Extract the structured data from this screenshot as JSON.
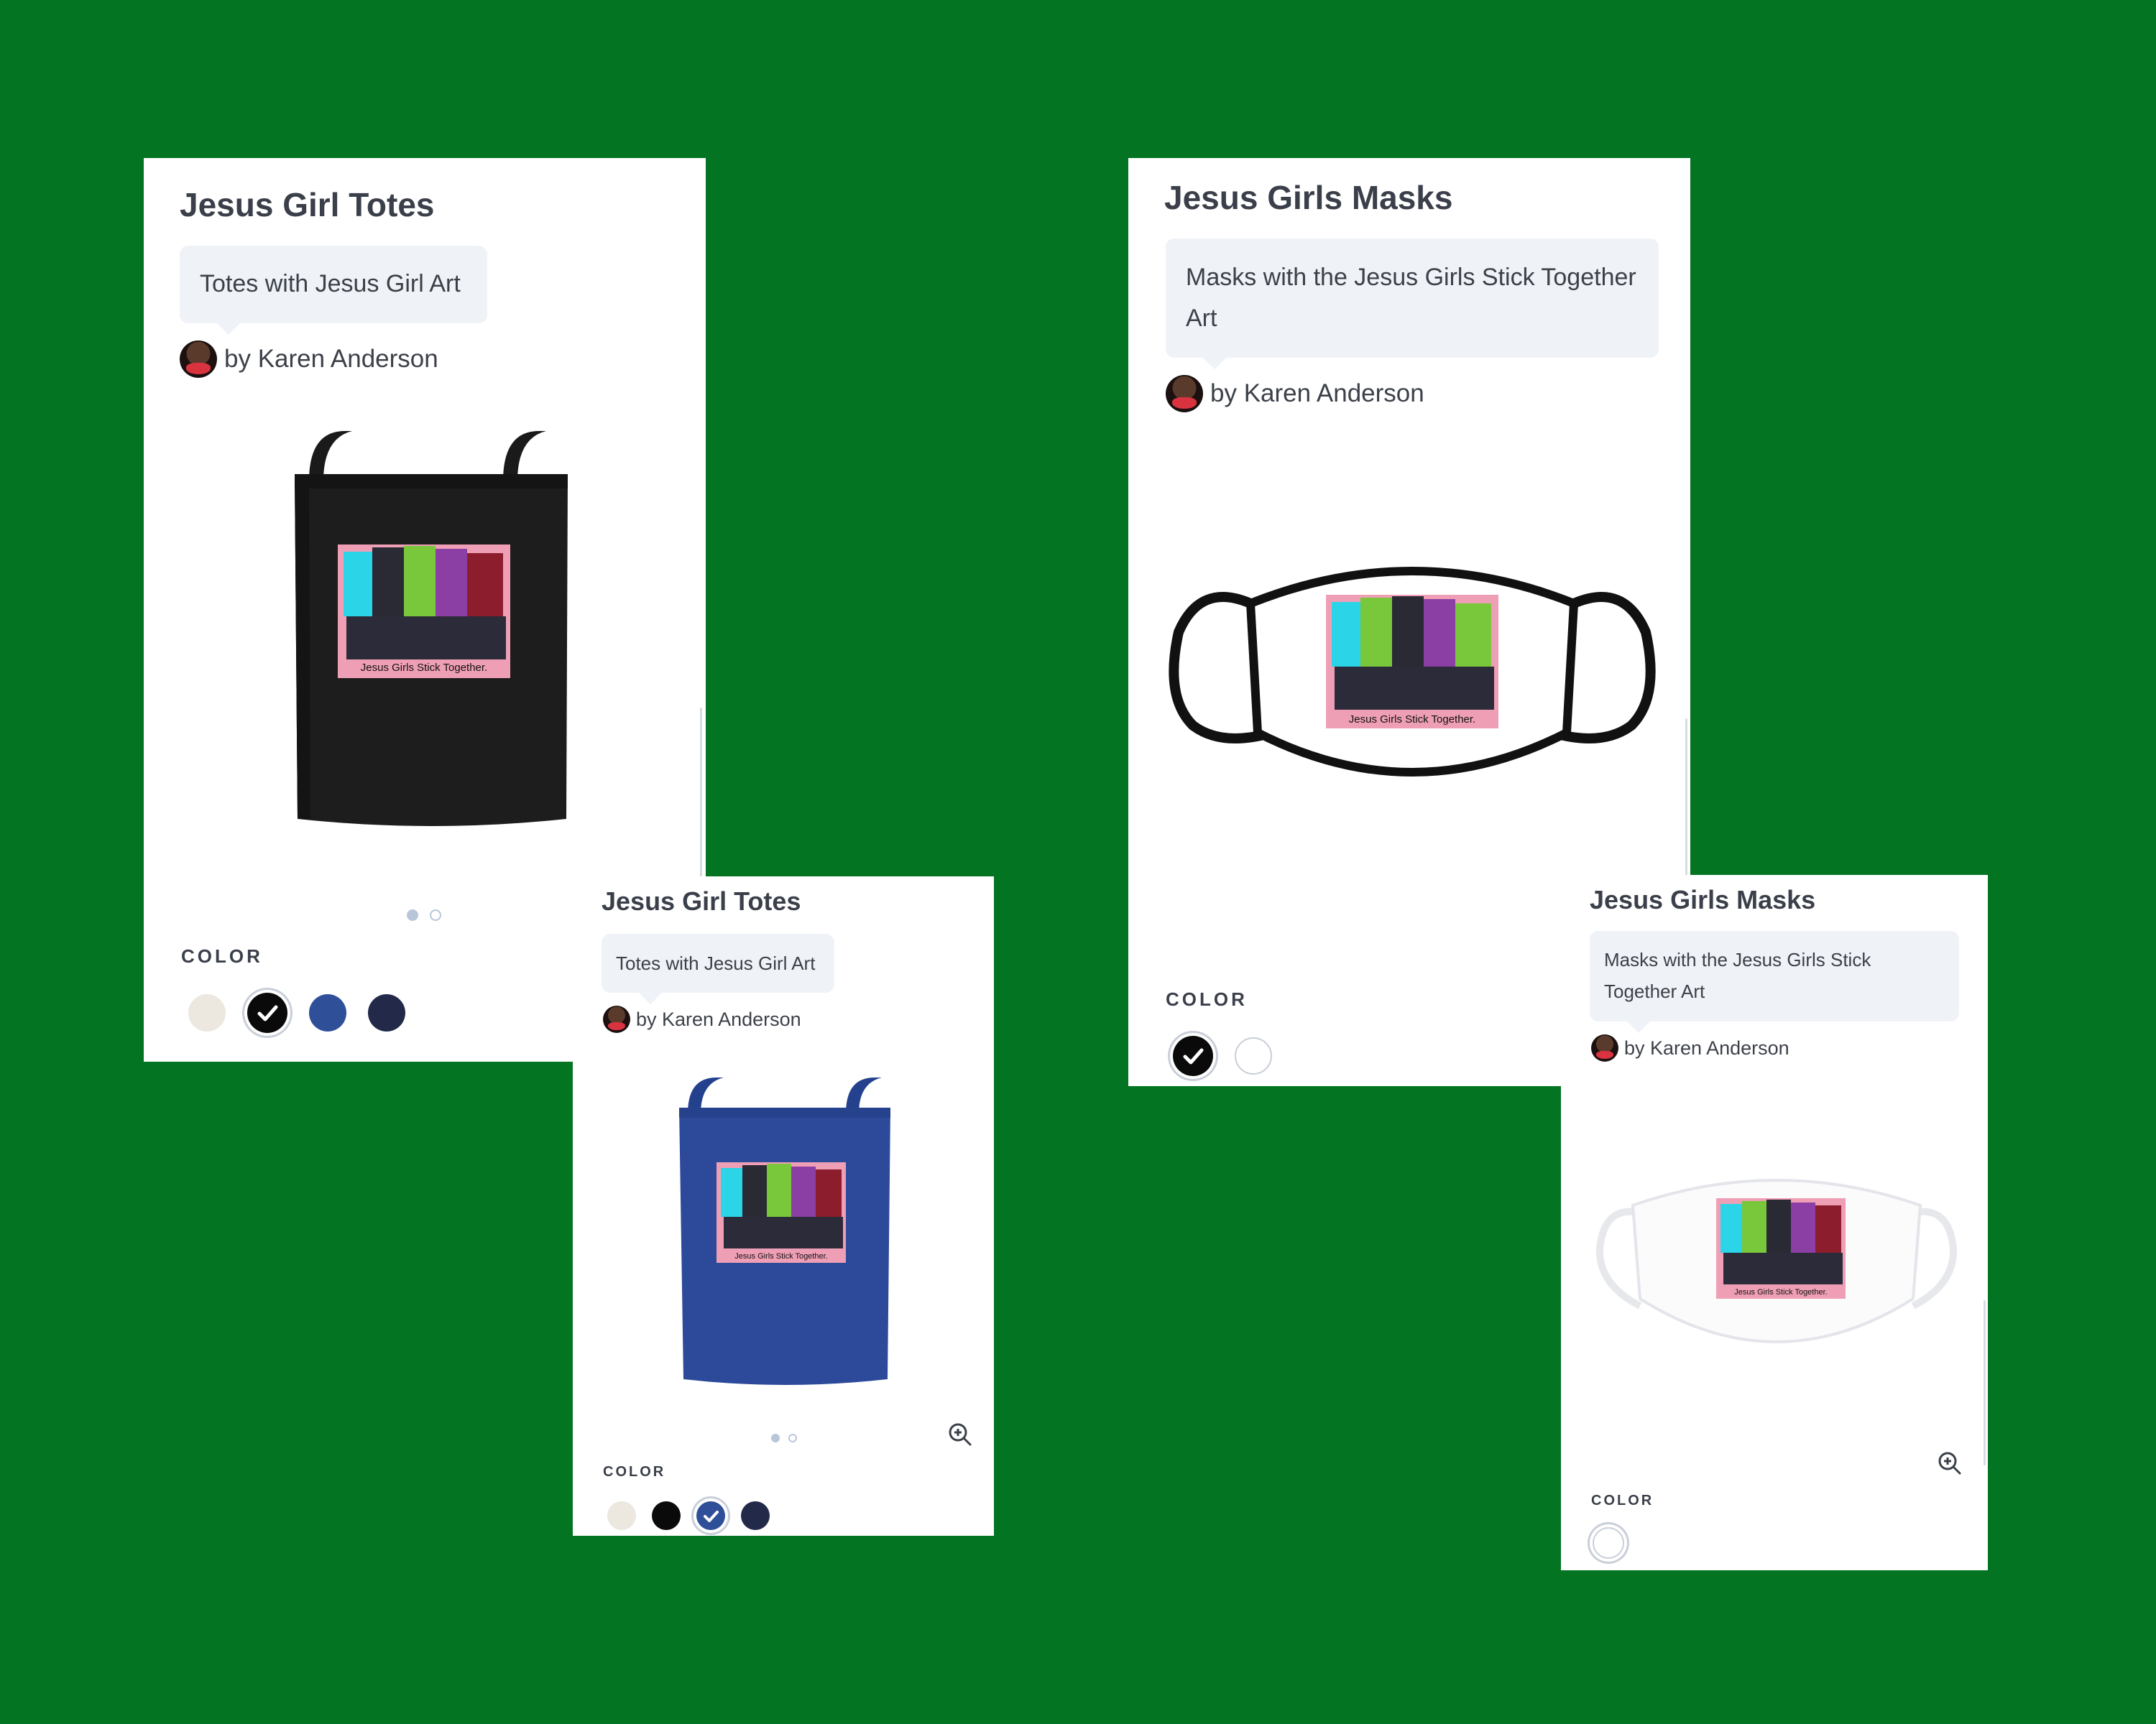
{
  "cards": [
    {
      "title": "Jesus Girl Totes",
      "description": "Totes with Jesus Girl Art",
      "byline": "by Karen Anderson",
      "color_label": "COLOR",
      "swatches": [
        "#ece7df",
        "#0a0a0a",
        "#2f4f99",
        "#232949"
      ],
      "selected_color": "#0a0a0a",
      "art_caption": "Jesus Girls Stick Together."
    },
    {
      "title": "Jesus Girl Totes",
      "description": "Totes with Jesus Girl Art",
      "byline": "by Karen Anderson",
      "color_label": "COLOR",
      "swatches": [
        "#ece7df",
        "#0a0a0a",
        "#2f4f99",
        "#232949"
      ],
      "selected_color": "#2f4f99",
      "art_caption": "Jesus Girls Stick Together."
    },
    {
      "title": "Jesus Girls Masks",
      "description": "Masks with the Jesus Girls Stick Together Art",
      "byline": "by Karen Anderson",
      "color_label": "COLOR",
      "swatches": [
        "#0a0a0a",
        "#ffffff"
      ],
      "selected_color": "#0a0a0a",
      "art_caption": "Jesus Girls Stick Together."
    },
    {
      "title": "Jesus Girls Masks",
      "description": "Masks with the Jesus Girls Stick Together Art",
      "byline": "by Karen Anderson",
      "color_label": "COLOR",
      "swatches": [
        "#ffffff"
      ],
      "selected_color": "",
      "art_caption": "Jesus Girls Stick Together."
    }
  ],
  "icons": {
    "zoom": "zoom-in-icon",
    "check": "check-icon",
    "avatar": "avatar-icon"
  },
  "colors": {
    "background": "#037422",
    "tote_black": "#1c1c1c",
    "tote_blue": "#2d4a9a",
    "art_pink": "#ef9fb5"
  }
}
